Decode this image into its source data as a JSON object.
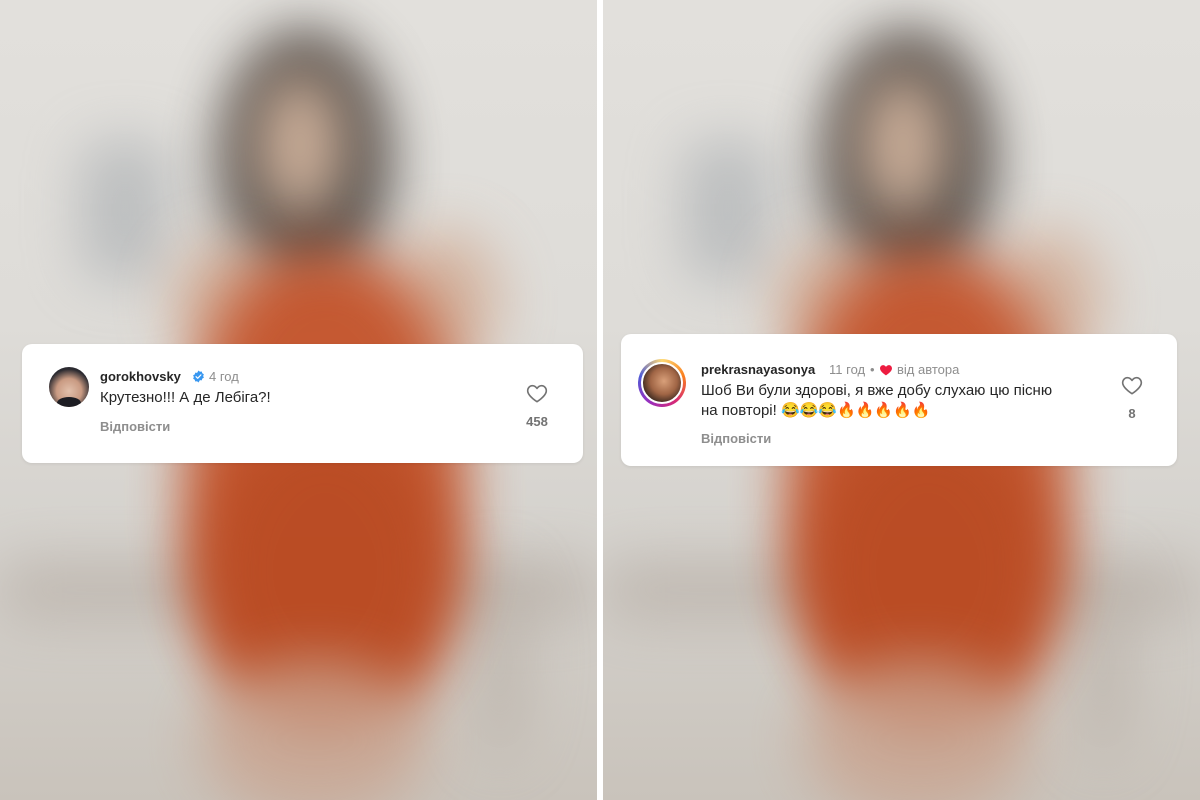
{
  "comments": [
    {
      "username": "gorokhovsky",
      "verified": true,
      "time": "4 год",
      "text": "Крутезно!!! А де Лебіга?!",
      "reply_label": "Відповісти",
      "likes": "458",
      "icons": [
        "avatar",
        "verified-badge-icon",
        "heart-outline-icon"
      ]
    },
    {
      "username": "prekrasnayasonya",
      "time": "11 год",
      "separator": "•",
      "author_liked_label": "від автора",
      "text_line1": "Шоб Ви були здорові, я вже добу слухаю цю пісню",
      "text_line2": "на повторі! 😂😂😂🔥🔥🔥🔥🔥",
      "reply_label": "Відповісти",
      "likes": "8",
      "icons": [
        "avatar",
        "red-heart-icon",
        "heart-outline-icon"
      ]
    }
  ],
  "colors": {
    "text": "#262626",
    "secondary": "#8e8e8e",
    "verified": "#3897f0",
    "author_heart": "#ed1c40",
    "dress": "#c4532a"
  }
}
